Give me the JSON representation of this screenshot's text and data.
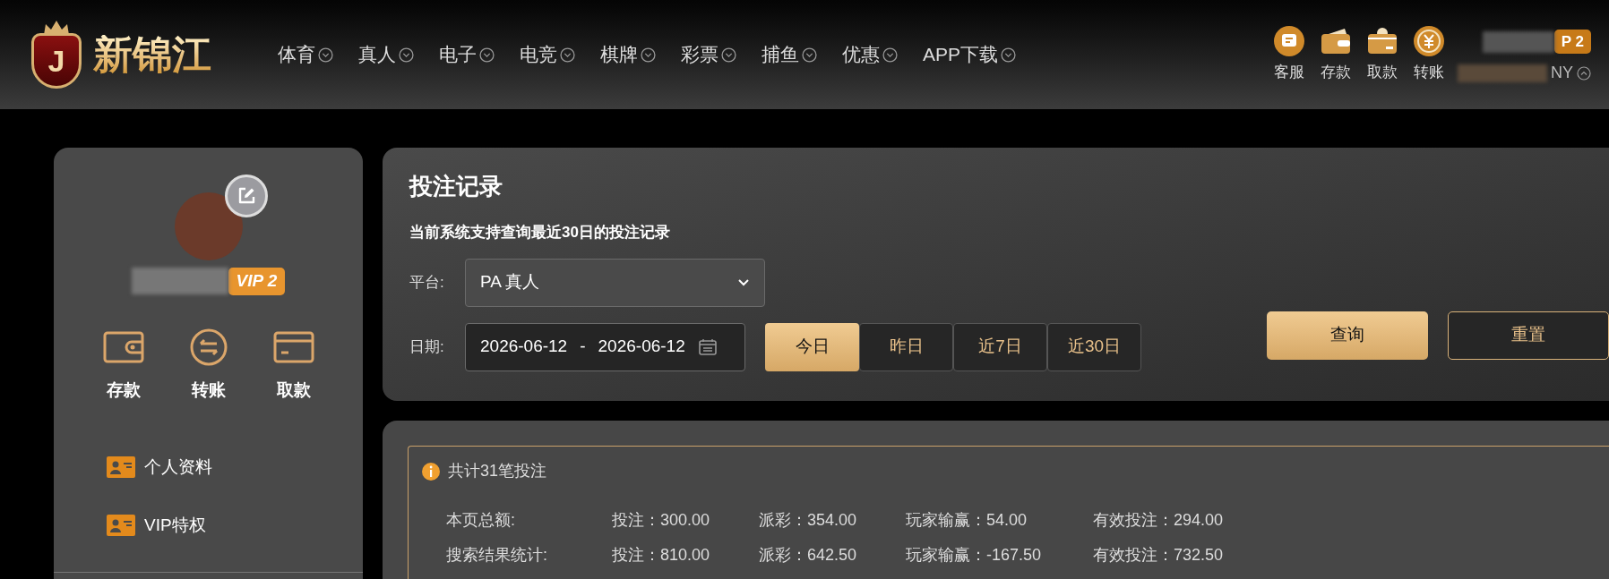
{
  "header": {
    "logo": {
      "emblem_letter": "J",
      "text": "新锦江"
    },
    "nav": [
      {
        "label": "体育"
      },
      {
        "label": "真人"
      },
      {
        "label": "电子"
      },
      {
        "label": "电竞"
      },
      {
        "label": "棋牌"
      },
      {
        "label": "彩票"
      },
      {
        "label": "捕鱼"
      },
      {
        "label": "优惠"
      },
      {
        "label": "APP下载"
      }
    ],
    "quick_actions": [
      {
        "label": "客服"
      },
      {
        "label": "存款"
      },
      {
        "label": "取款"
      },
      {
        "label": "转账"
      }
    ],
    "user": {
      "vip_badge": "P 2",
      "currency": "NY"
    }
  },
  "sidebar": {
    "vip_badge": "VIP 2",
    "actions": [
      {
        "label": "存款"
      },
      {
        "label": "转账"
      },
      {
        "label": "取款"
      }
    ],
    "menu": [
      {
        "label": "个人资料"
      },
      {
        "label": "VIP特权"
      }
    ]
  },
  "filter": {
    "title": "投注记录",
    "notice": "当前系统支持查询最近30日的投注记录",
    "platform": {
      "label": "平台:",
      "value": "PA 真人"
    },
    "date": {
      "label": "日期:",
      "start": "2026-06-12",
      "separator": "-",
      "end": "2026-06-12"
    },
    "ranges": [
      {
        "label": "今日",
        "selected": true
      },
      {
        "label": "昨日",
        "selected": false
      },
      {
        "label": "近7日",
        "selected": false
      },
      {
        "label": "近30日",
        "selected": false
      }
    ],
    "buttons": [
      {
        "label": "查询",
        "kind": "primary"
      },
      {
        "label": "重置",
        "kind": "secondary"
      }
    ]
  },
  "summary": {
    "total": "共计31笔投注",
    "rows": [
      {
        "label": "本页总额:",
        "cells": [
          "投注：300.00",
          "派彩：354.00",
          "玩家输赢：54.00",
          "有效投注：294.00"
        ]
      },
      {
        "label": "搜索结果统计:",
        "cells": [
          "投注：810.00",
          "派彩：642.50",
          "玩家输赢：-167.50",
          "有效投注：732.50"
        ]
      }
    ]
  }
}
